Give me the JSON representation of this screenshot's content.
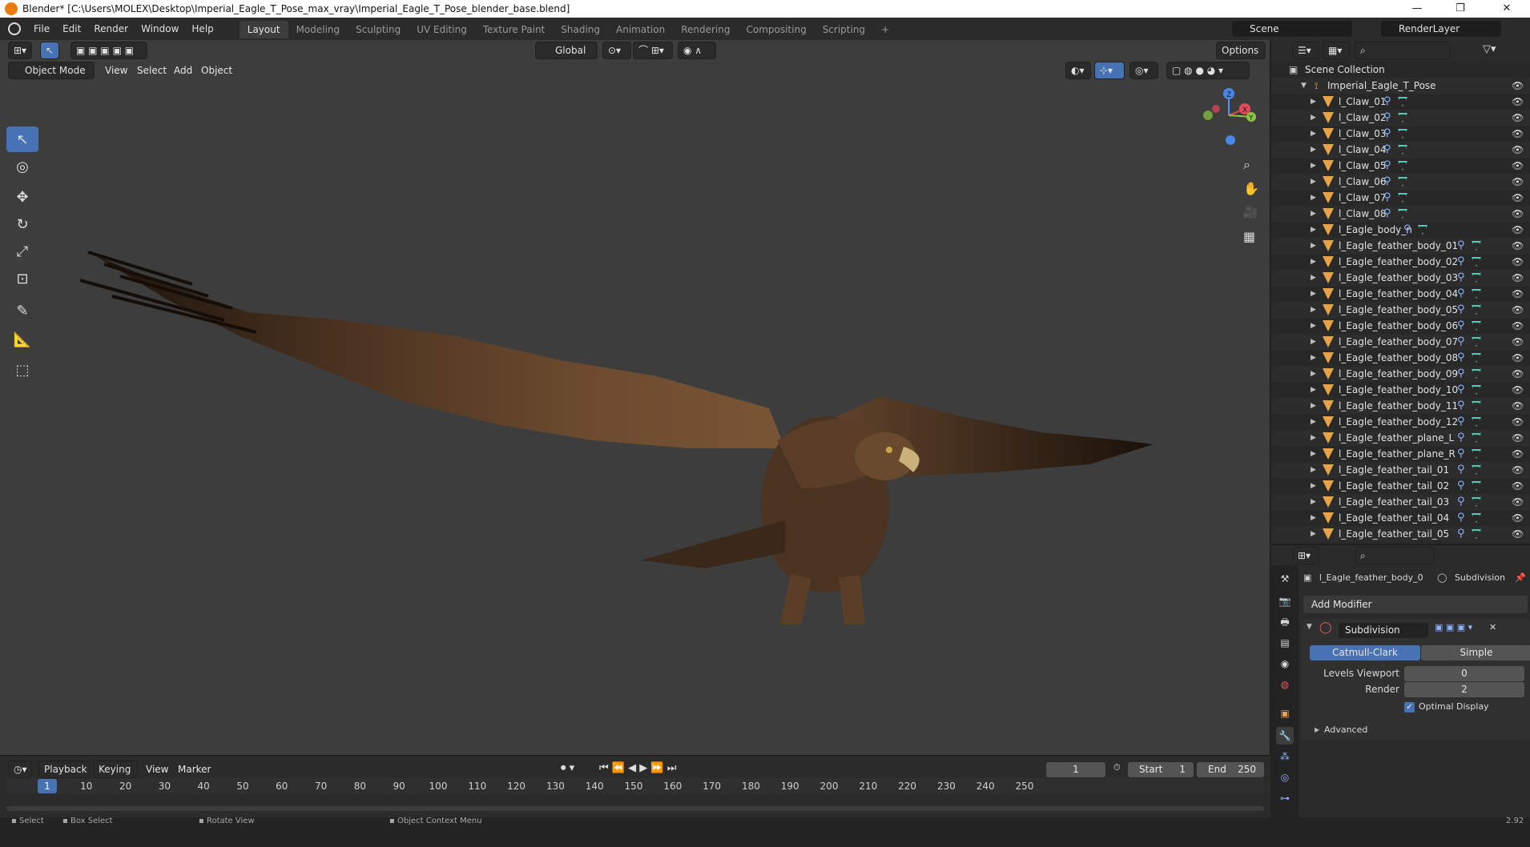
{
  "window": {
    "title": "Blender* [C:\\Users\\MOLEX\\Desktop\\Imperial_Eagle_T_Pose_max_vray\\Imperial_Eagle_T_Pose_blender_base.blend]",
    "minimize": "—",
    "maximize": "❐",
    "close": "✕"
  },
  "menu": [
    "File",
    "Edit",
    "Render",
    "Window",
    "Help"
  ],
  "workspaces": [
    "Layout",
    "Modeling",
    "Sculpting",
    "UV Editing",
    "Texture Paint",
    "Shading",
    "Animation",
    "Rendering",
    "Compositing",
    "Scripting",
    "+"
  ],
  "scene": {
    "name": "Scene",
    "render_layer": "RenderLayer"
  },
  "viewport": {
    "transform_orientation": "Global",
    "options_label": "Options",
    "mode": "Object Mode",
    "menus": [
      "View",
      "Select",
      "Add",
      "Object"
    ],
    "gizmo_axes": [
      "Z",
      "X",
      "Y"
    ]
  },
  "outliner": {
    "root": "Scene Collection",
    "collection": "Imperial_Eagle_T_Pose",
    "items": [
      "l_Claw_01",
      "l_Claw_02",
      "l_Claw_03",
      "l_Claw_04",
      "l_Claw_05",
      "l_Claw_06",
      "l_Claw_07",
      "l_Claw_08",
      "l_Eagle_body_n",
      "l_Eagle_feather_body_01",
      "l_Eagle_feather_body_02",
      "l_Eagle_feather_body_03",
      "l_Eagle_feather_body_04",
      "l_Eagle_feather_body_05",
      "l_Eagle_feather_body_06",
      "l_Eagle_feather_body_07",
      "l_Eagle_feather_body_08",
      "l_Eagle_feather_body_09",
      "l_Eagle_feather_body_10",
      "l_Eagle_feather_body_11",
      "l_Eagle_feather_body_12",
      "l_Eagle_feather_plane_L",
      "l_Eagle_feather_plane_R",
      "l_Eagle_feather_tail_01",
      "l_Eagle_feather_tail_02",
      "l_Eagle_feather_tail_03",
      "l_Eagle_feather_tail_04",
      "l_Eagle_feather_tail_05"
    ]
  },
  "properties": {
    "object_name": "l_Eagle_feather_body_0",
    "modifier_context": "Subdivision",
    "add_modifier": "Add Modifier",
    "modifier_name": "Subdivision",
    "algorithms": [
      "Catmull-Clark",
      "Simple"
    ],
    "selected_algorithm": "Catmull-Clark",
    "levels_viewport_label": "Levels Viewport",
    "levels_viewport": "0",
    "render_label": "Render",
    "render": "2",
    "optimal_display_label": "Optimal Display",
    "optimal_display": true,
    "advanced_label": "Advanced"
  },
  "timeline": {
    "menus": [
      "Playback",
      "Keying",
      "View",
      "Marker"
    ],
    "current_frame": "1",
    "start_label": "Start",
    "start": "1",
    "end_label": "End",
    "end": "250",
    "ticks": [
      "10",
      "20",
      "30",
      "40",
      "50",
      "60",
      "70",
      "80",
      "90",
      "100",
      "110",
      "120",
      "130",
      "140",
      "150",
      "160",
      "170",
      "180",
      "190",
      "200",
      "210",
      "220",
      "230",
      "240",
      "250"
    ],
    "playhead": "1"
  },
  "status": {
    "items": [
      "Select",
      "Box Select",
      "Rotate View",
      "Object Context Menu"
    ],
    "version": "2.92"
  }
}
